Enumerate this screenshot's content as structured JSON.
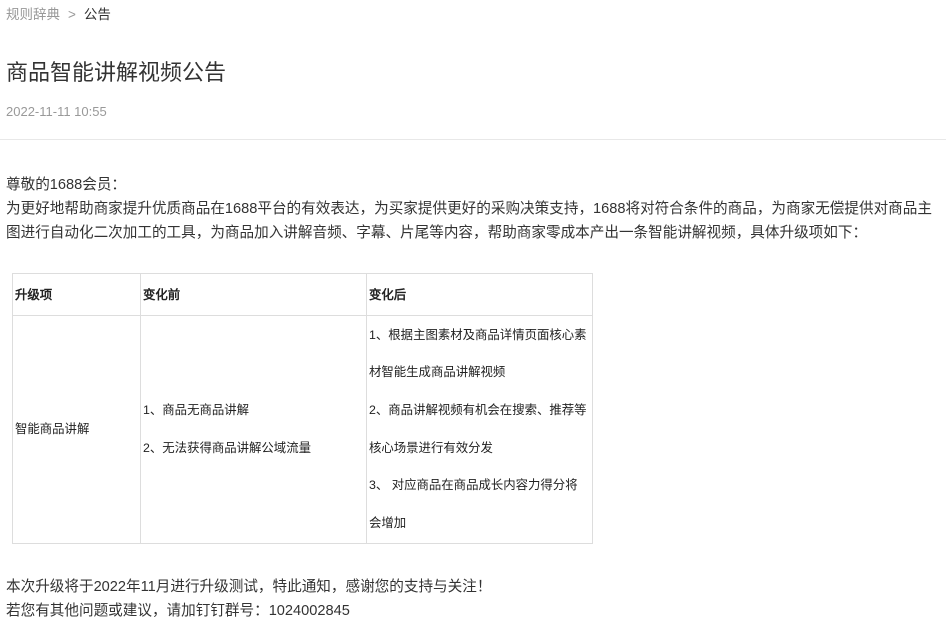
{
  "breadcrumb": {
    "items": [
      "规则辞典",
      "公告"
    ],
    "separator": ">"
  },
  "article": {
    "title": "商品智能讲解视频公告",
    "date": "2022-11-11 10:55",
    "greeting": "尊敬的1688会员：",
    "intro_lines": [
      "为更好地帮助商家提升优质商品在1688平台的有效表达，为买家提供更好的采购决策支持，1688将对符合条件的商品，为商家无偿提供对商品主",
      "图进行自动化二次加工的工具，为商品加入讲解音频、字幕、片尾等内容，帮助商家零成本产出一条智能讲解视频，具体升级项如下："
    ],
    "table": {
      "headers": [
        "升级项",
        "变化前",
        "变化后"
      ],
      "rows": [
        {
          "item": "智能商品讲解",
          "before": [
            "1、商品无商品讲解",
            "2、无法获得商品讲解公域流量"
          ],
          "after": [
            [
              "1、根据主图素材及商品详情页面核心素",
              "材智能生成商品讲解视频"
            ],
            [
              "2、商品讲解视频有机会在搜索、推荐等",
              "核心场景进行有效分发"
            ],
            [
              "3、 对应商品在商品成长内容力得分将",
              "会增加"
            ]
          ]
        }
      ]
    },
    "closing_lines": [
      "本次升级将于2022年11月进行升级测试，特此通知，感谢您的支持与关注！",
      "若您有其他问题或建议，请加钉钉群号：1024002845"
    ]
  },
  "colors": {
    "text": "#333333",
    "muted": "#999999",
    "divider": "#e8e8e8",
    "table_border": "#dddddd"
  }
}
